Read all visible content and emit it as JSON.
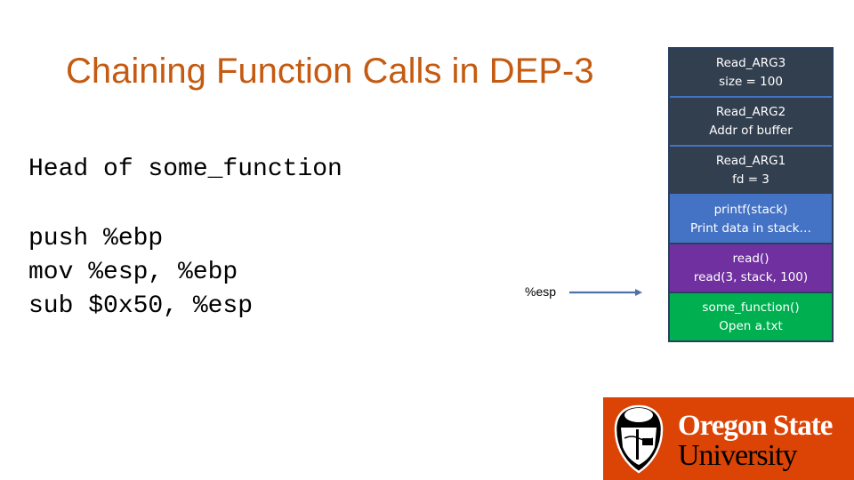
{
  "slide": {
    "title": "Chaining Function Calls in DEP-3",
    "code_heading": "Head of some_function",
    "code_lines": [
      "push %ebp",
      "mov %esp, %ebp",
      "sub $0x50, %esp"
    ],
    "esp_pointer": {
      "label": "%esp",
      "icon": "arrow-right-icon",
      "points_to": "read()"
    }
  },
  "stack": [
    {
      "line1": "Read_ARG3",
      "line2": "size = 100",
      "color": "#323f4f"
    },
    {
      "line1": "Read_ARG2",
      "line2": "Addr of buffer",
      "color": "#323f4f"
    },
    {
      "line1": "Read_ARG1",
      "line2": "fd = 3",
      "color": "#323f4f"
    },
    {
      "line1": "printf(stack)",
      "line2": "Print data in stack…",
      "color": "#4472c4"
    },
    {
      "line1": "read()",
      "line2": "read(3, stack, 100)",
      "color": "#7030a0"
    },
    {
      "line1": "some_function()",
      "line2": "Open a.txt",
      "color": "#00b050"
    }
  ],
  "logo": {
    "line1": "Oregon State",
    "line2": "University",
    "icon": "beaver-shield-icon",
    "color": "#dc4405"
  },
  "colors": {
    "title": "#c55a11",
    "arrow": "#4f6fa8"
  }
}
